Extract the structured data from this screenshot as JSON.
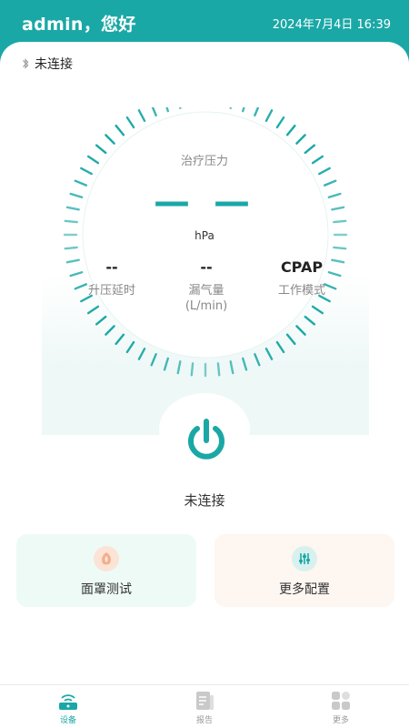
{
  "header": {
    "greeting": "admin，您好",
    "datetime": "2024年7月4日  16:39"
  },
  "bluetooth": {
    "icon": "bluetooth-icon",
    "status": "未连接"
  },
  "dial": {
    "label": "治疗压力",
    "value": "— —",
    "unit": "hPa"
  },
  "stats": [
    {
      "value": "--",
      "label": "升压延时",
      "sub": ""
    },
    {
      "value": "--",
      "label": "漏气量",
      "sub": "(L/min)"
    },
    {
      "value": "CPAP",
      "label": "工作模式",
      "sub": ""
    }
  ],
  "power": {
    "icon": "power-icon",
    "status": "未连接"
  },
  "tiles": [
    {
      "icon": "mask-icon",
      "label": "面罩测试"
    },
    {
      "icon": "sliders-icon",
      "label": "更多配置"
    }
  ],
  "tabs": [
    {
      "icon": "device-icon",
      "label": "设备",
      "active": true
    },
    {
      "icon": "report-icon",
      "label": "报告",
      "active": false
    },
    {
      "icon": "grid-icon",
      "label": "更多",
      "active": false
    }
  ],
  "colors": {
    "accent": "#1aa8a6",
    "mask_tile_bg": "#eefaf6",
    "config_tile_bg": "#fdf6f1"
  }
}
